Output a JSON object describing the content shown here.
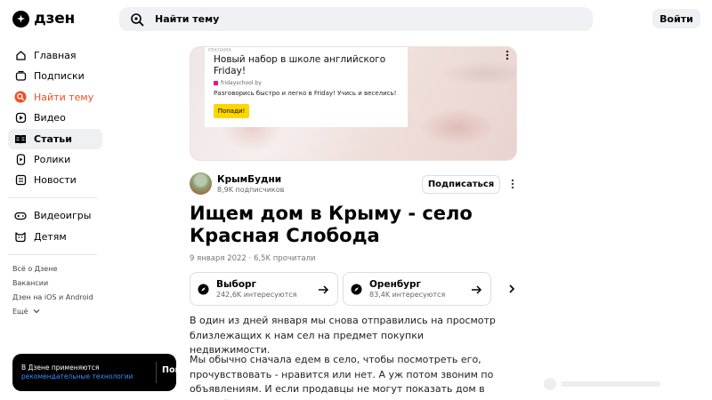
{
  "header": {
    "logo_text": "дзен",
    "search_text": "Найти тему",
    "login_label": "Войти"
  },
  "sidebar": {
    "items": [
      {
        "label": "Главная",
        "icon": "home-icon"
      },
      {
        "label": "Подписки",
        "icon": "subscriptions-icon"
      },
      {
        "label": "Найти тему",
        "icon": "search-topic-icon"
      },
      {
        "label": "Видео",
        "icon": "video-icon"
      },
      {
        "label": "Статьи",
        "icon": "articles-icon"
      },
      {
        "label": "Ролики",
        "icon": "clips-icon"
      },
      {
        "label": "Новости",
        "icon": "news-icon"
      }
    ],
    "items2": [
      {
        "label": "Видеоигры",
        "icon": "gamepad-icon"
      },
      {
        "label": "Детям",
        "icon": "kids-icon"
      }
    ],
    "footer_links": [
      "Всё о Дзене",
      "Вакансии",
      "Дзен на iOS и Android",
      "Ещё"
    ]
  },
  "ad": {
    "tag": "РЕКЛАМА",
    "title": "Новый набор в школе английского Friday!",
    "site": "fridayschool.by",
    "description": "Разговорись быстро и легко в Friday! Учись и веселись!",
    "cta": "Попади!"
  },
  "channel": {
    "name": "КрымБудни",
    "subscribers": "8,9K подписчиков",
    "subscribe_label": "Подписаться"
  },
  "article": {
    "title": "Ищем дом в Крыму - село Красная Слобода",
    "meta": "9 января 2022 · 6,5K прочитали",
    "paragraph1": "В один из дней января мы снова отправились на просмотр близлежащих к нам сел на предмет покупки недвижимости.",
    "paragraph2": "Мы обычно сначала едем в село, чтобы посмотреть его, прочувствовать - нравится или нет. А уж потом звоним по объявлениям. И если продавцы не могут показать дом в данный"
  },
  "tags": [
    {
      "name": "Выборг",
      "sub": "242,6K интересуются"
    },
    {
      "name": "Оренбург",
      "sub": "83,4K интересуются"
    }
  ],
  "cookie": {
    "text": "В Дзене применяются",
    "link": "рекомендательные технологии",
    "ok": "Понятно"
  },
  "colors": {
    "accent": "#f04e23",
    "link": "#3d8bff",
    "cta": "#ffd500"
  }
}
